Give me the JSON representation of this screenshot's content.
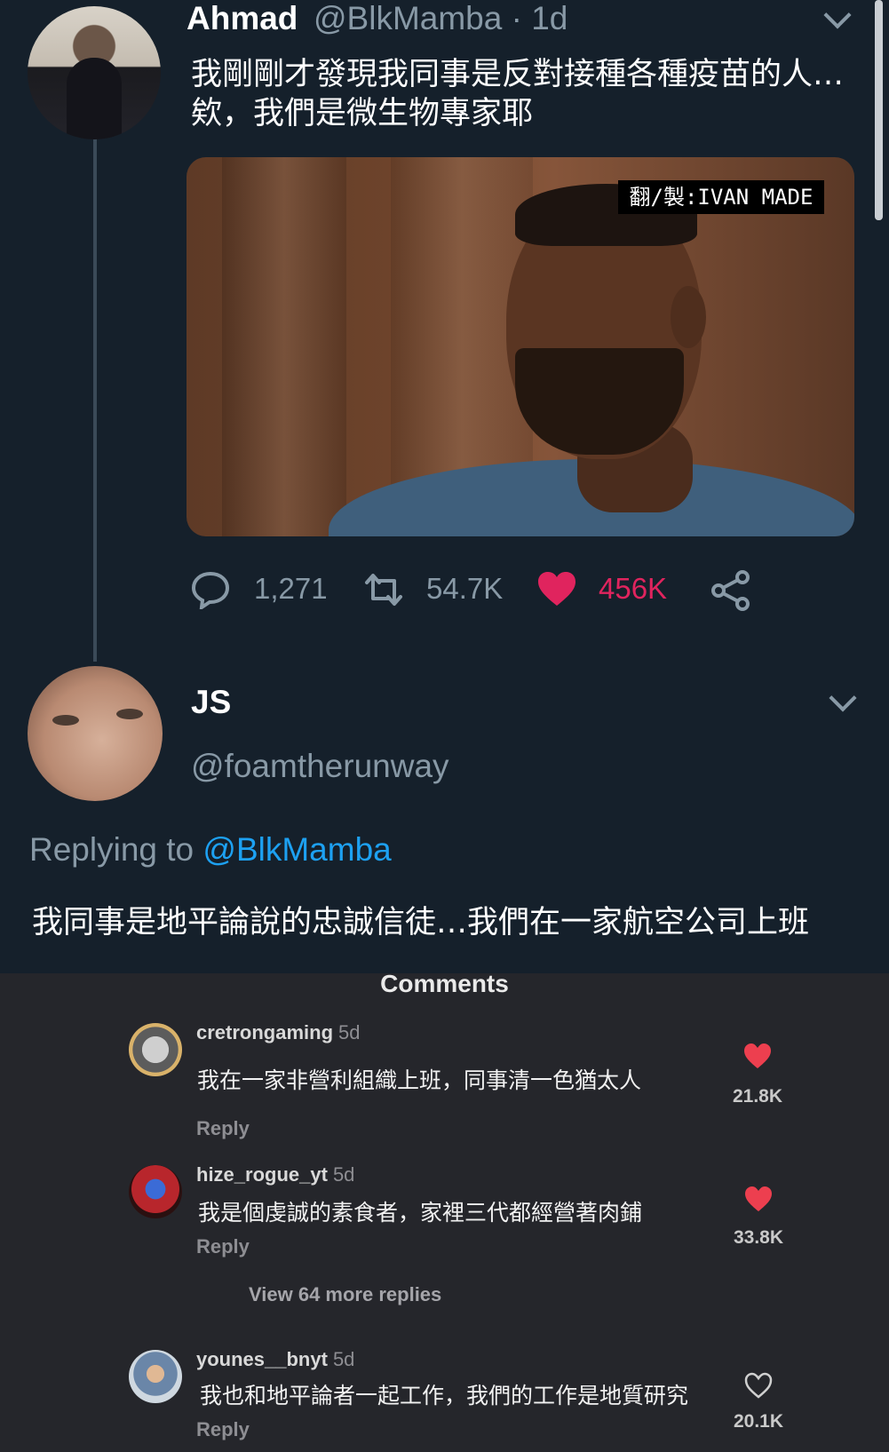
{
  "tweet": {
    "name": "Ahmad",
    "handle_time": "@BlkMamba · 1d",
    "text": "我剛剛才發現我同事是反對接種各種疫苗的人…欸，我們是微生物專家耶",
    "watermark": "翻/製:IVAN MADE",
    "stats": {
      "replies": "1,271",
      "retweets": "54.7K",
      "likes": "456K"
    }
  },
  "reply": {
    "name": "JS",
    "handle": "@foamtherunway",
    "replying_to_prefix": "Replying to ",
    "replying_to_handle": "@BlkMamba",
    "text": "我同事是地平論說的忠誠信徒…我們在一家航空公司上班"
  },
  "comments_section": {
    "title": "Comments",
    "view_more": "View 64 more replies",
    "items": [
      {
        "user": "cretrongaming",
        "ago": "5d",
        "text": "我在一家非營利組織上班，同事清一色猶太人",
        "reply": "Reply",
        "likes": "21.8K",
        "liked": true
      },
      {
        "user": "hize_rogue_yt",
        "ago": "5d",
        "text": "我是個虔誠的素食者，家裡三代都經營著肉鋪",
        "reply": "Reply",
        "likes": "33.8K",
        "liked": true
      },
      {
        "user": "younes__bnyt",
        "ago": "5d",
        "text": "我也和地平論者一起工作，我們的工作是地質研究",
        "reply": "Reply",
        "likes": "20.1K",
        "liked": false
      }
    ]
  },
  "colors": {
    "background": "#15202b",
    "muted": "#8899a6",
    "link": "#1da1f2",
    "like": "#e0245e",
    "comments_bg": "#25262b",
    "heart_red": "#ed3f4f"
  }
}
